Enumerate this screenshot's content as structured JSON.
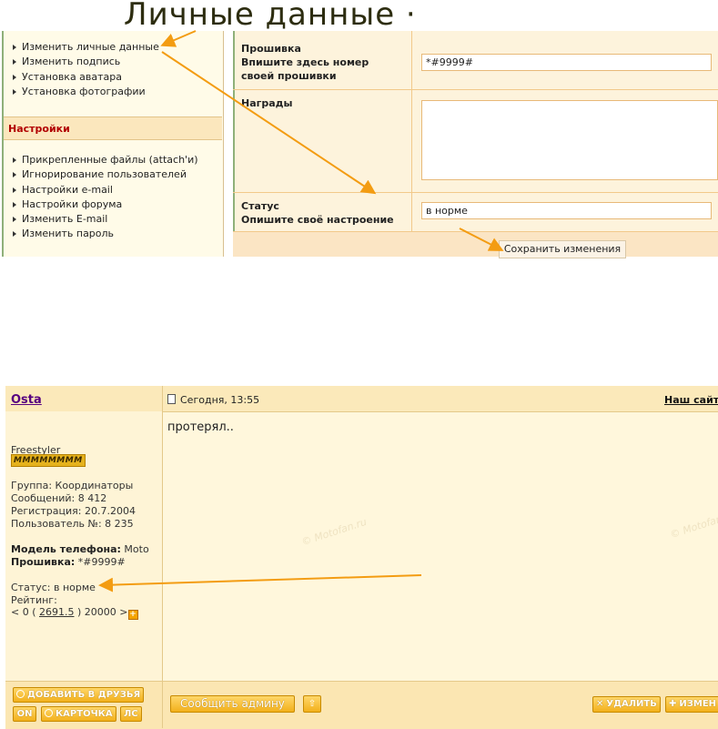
{
  "caption": "Личные данные  ·",
  "nav": {
    "personal_items": [
      "Изменить личные данные",
      "Изменить подпись",
      "Установка аватара",
      "Установка фотографии"
    ],
    "settings_header": "Настройки",
    "settings_items": [
      "Прикрепленные файлы (attach'и)",
      "Игнорирование пользователей",
      "Настройки e-mail",
      "Настройки форума",
      "Изменить E-mail",
      "Изменить пароль"
    ]
  },
  "form": {
    "firmware_label": "Прошивка",
    "firmware_hint_1": "Впишите здесь номер",
    "firmware_hint_2": "своей прошивки",
    "firmware_value": "*#9999#",
    "awards_label": "Награды",
    "status_label": "Статус",
    "status_hint": "Опишите своё настроение",
    "status_value": "в норме",
    "save_label": "Сохранить изменения"
  },
  "post": {
    "author": "Osta",
    "date": "Сегодня, 13:55",
    "our_site": "Наш сайт",
    "body": "протерял..",
    "rank_title": "Freestyler",
    "rank_stars": "MMMMMMMM",
    "group": "Группа: Координаторы",
    "messages": "Сообщений: 8 412",
    "registered": "Регистрация: 20.7.2004",
    "user_no": "Пользователь №: 8 235",
    "phone_label": "Модель телефона:",
    "phone_value": " Moto",
    "fw_label": "Прошивка:",
    "fw_value": " *#9999#",
    "status": "Статус: в норме",
    "rating_label": "Рейтинг:",
    "rating_pre": "< 0 ( ",
    "rating_value": "2691.5",
    "rating_post": " ) 20000 >",
    "watermark": "© Motofan.ru"
  },
  "footer": {
    "add_friend": "ДОБАВИТЬ В ДРУЗЬЯ",
    "on": "ON",
    "card": "КАРТОЧКА",
    "pm": "ЛС",
    "report": "Сообщить админу",
    "up_arrow": "⇧",
    "delete": "УДАЛИТЬ",
    "edit": "ИЗМЕН"
  },
  "colors": {
    "arrow": "#f39c12",
    "accent_red": "#b20000",
    "author": "#560080"
  }
}
